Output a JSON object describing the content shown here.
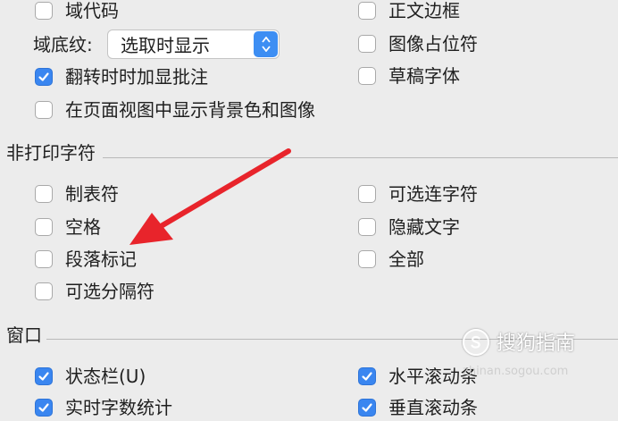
{
  "display": {
    "field_codes": {
      "label": "域代码",
      "checked": false
    },
    "field_shading": {
      "label": "域底纹:",
      "value": "选取时显示"
    },
    "flip_comments": {
      "label": "翻转时时加显批注",
      "checked": true
    },
    "page_background": {
      "label": "在页面视图中显示背景色和图像",
      "checked": false
    },
    "text_boundaries": {
      "label": "正文边框",
      "checked": false
    },
    "image_placeholder": {
      "label": "图像占位符",
      "checked": false
    },
    "draft_font": {
      "label": "草稿字体",
      "checked": false
    }
  },
  "nonprinting": {
    "title": "非打印字符",
    "tab_chars": {
      "label": "制表符",
      "checked": false
    },
    "spaces": {
      "label": "空格",
      "checked": false
    },
    "paragraph_marks": {
      "label": "段落标记",
      "checked": false
    },
    "optional_breaks": {
      "label": "可选分隔符",
      "checked": false
    },
    "optional_hyphens": {
      "label": "可选连字符",
      "checked": false
    },
    "hidden_text": {
      "label": "隐藏文字",
      "checked": false
    },
    "all": {
      "label": "全部",
      "checked": false
    }
  },
  "window": {
    "title": "窗口",
    "status_bar": {
      "label": "状态栏(U)",
      "checked": true
    },
    "live_word_count": {
      "label": "实时字数统计",
      "checked": true
    },
    "horizontal_scrollbar": {
      "label": "水平滚动条",
      "checked": true
    },
    "vertical_scrollbar": {
      "label": "垂直滚动条",
      "checked": true
    }
  },
  "watermark": {
    "brand": "搜狗指南",
    "url": "zhinan.sogou.com"
  },
  "colors": {
    "accent": "#3a86f0",
    "arrow": "#e8242b"
  }
}
